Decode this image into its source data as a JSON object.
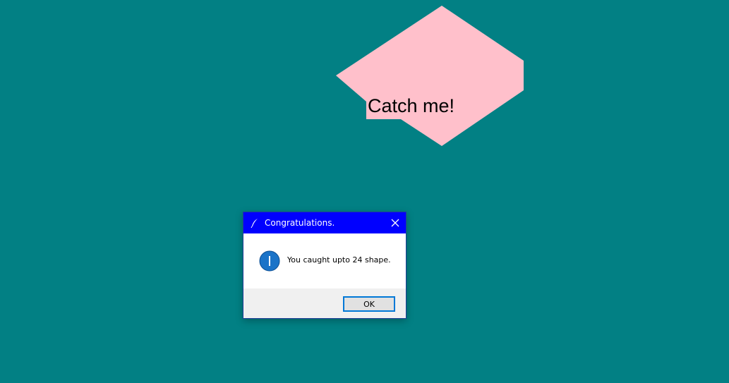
{
  "app": {
    "background_color": "#028084"
  },
  "game": {
    "shape_label": "Catch me!",
    "shape_color": "#ffc0cb"
  },
  "dialog": {
    "title": "Congratulations.",
    "title_icon": "feather-icon",
    "close_icon": "close-icon",
    "message": "You caught upto 24 shape.",
    "message_icon": "info-icon",
    "ok_label": "OK",
    "titlebar_color": "#0000ff"
  }
}
